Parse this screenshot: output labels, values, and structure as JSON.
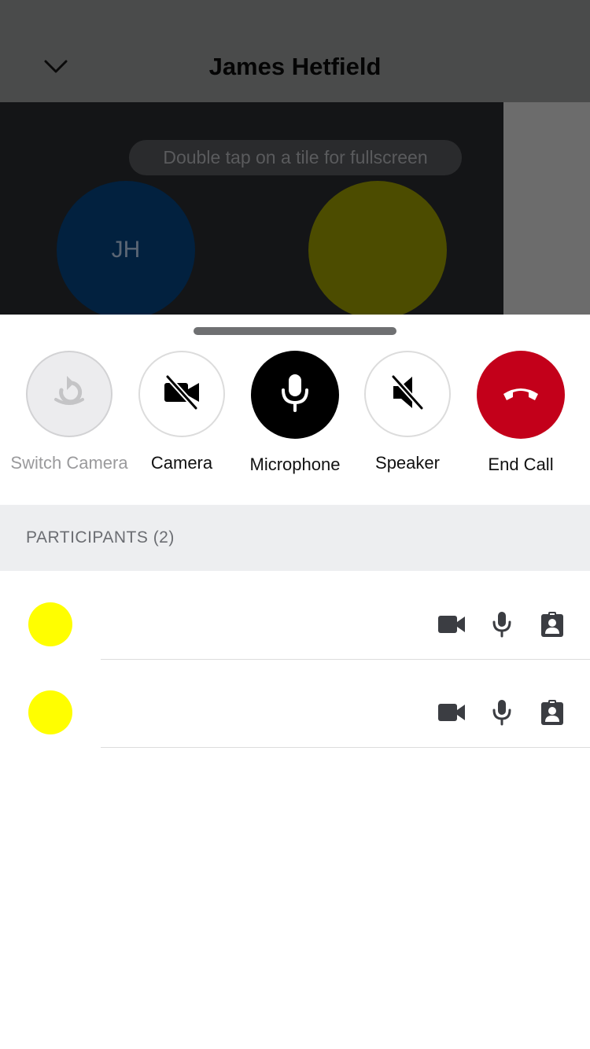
{
  "header": {
    "title": "James Hetfield",
    "collapse_icon": "chevron-down-icon"
  },
  "video": {
    "hint": "Double tap on a tile for fullscreen",
    "tiles": [
      {
        "initials": "JH",
        "color": "#02213f"
      },
      {
        "initials": "",
        "color": "#4c4c00"
      }
    ]
  },
  "controls": [
    {
      "label": "Switch Camera",
      "icon": "switch-camera-icon",
      "state": "disabled"
    },
    {
      "label": "Camera",
      "icon": "video-off-icon",
      "state": "off"
    },
    {
      "label": "Microphone",
      "icon": "microphone-icon",
      "state": "on"
    },
    {
      "label": "Speaker",
      "icon": "speaker-off-icon",
      "state": "off"
    },
    {
      "label": "End Call",
      "icon": "end-call-icon",
      "color": "#c3001a"
    }
  ],
  "participants": {
    "title": "PARTICIPANTS (2)",
    "items": [
      {
        "avatar_color": "#fffe00",
        "icons": [
          "video-icon",
          "microphone-icon",
          "contact-badge-icon"
        ]
      },
      {
        "avatar_color": "#fffe00",
        "icons": [
          "video-icon",
          "microphone-icon",
          "contact-badge-icon"
        ]
      }
    ]
  }
}
